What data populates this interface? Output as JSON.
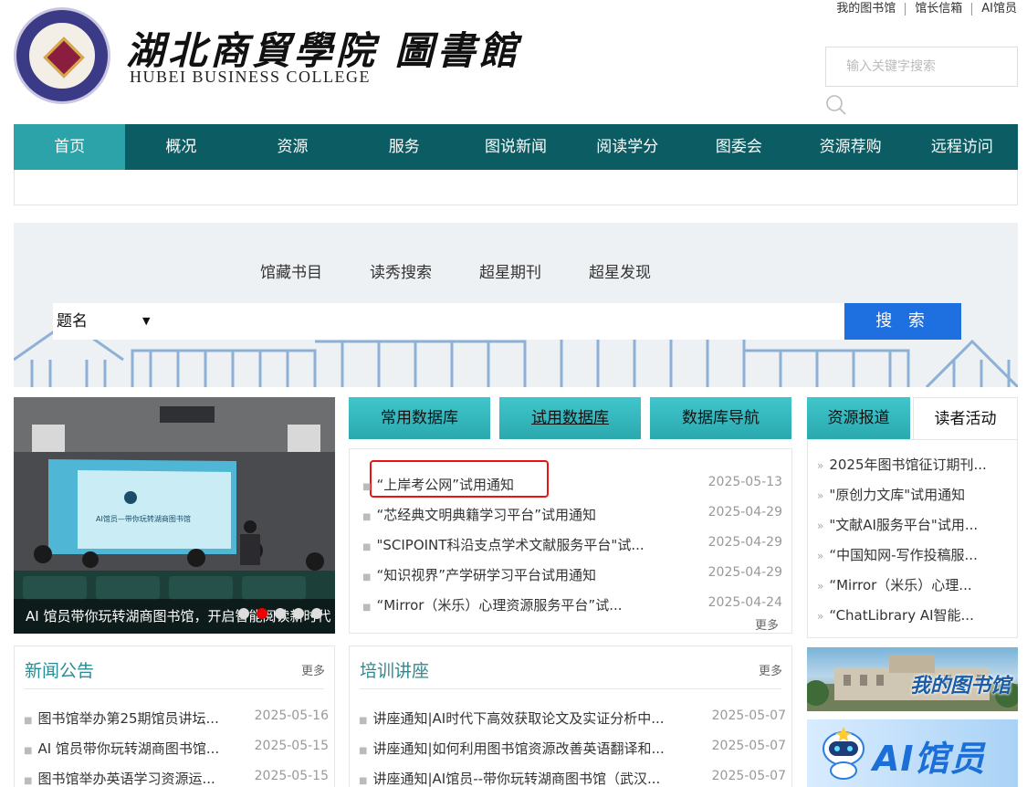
{
  "header": {
    "logo_cn": "湖北商貿學院 圖書館",
    "logo_en": "HUBEI BUSINESS COLLEGE",
    "seal_text": "湖北商貿學院",
    "top_links": [
      "我的图书馆",
      "馆长信箱",
      "AI馆员"
    ],
    "search_placeholder": "输入关键字搜索"
  },
  "nav": {
    "items": [
      "首页",
      "概况",
      "资源",
      "服务",
      "图说新闻",
      "阅读学分",
      "图委会",
      "资源荐购",
      "远程访问"
    ],
    "active": "首页"
  },
  "catalog_search": {
    "tabs": [
      "馆藏书目",
      "读秀搜索",
      "超星期刊",
      "超星发现"
    ],
    "field_type": "题名",
    "button": "搜 索"
  },
  "slider": {
    "caption": "AI 馆员带你玩转湖商图书馆，开启智能阅读新时代",
    "screen_text": "AI馆员—带你玩转湖商图书馆",
    "dots": 5,
    "active_dot": 1
  },
  "databases": {
    "tabs": [
      "常用数据库",
      "试用数据库",
      "数据库导航"
    ],
    "active_tab": "试用数据库",
    "items": [
      {
        "title": "“上岸考公网”试用通知",
        "date": "2025-05-13"
      },
      {
        "title": "“芯经典文明典籍学习平台”试用通知",
        "date": "2025-04-29"
      },
      {
        "title": "\"SCIPOINT科沿支点学术文献服务平台\"试...",
        "date": "2025-04-29"
      },
      {
        "title": "“知识视界”产学研学习平台试用通知",
        "date": "2025-04-29"
      },
      {
        "title": "“Mirror（米乐）心理资源服务平台”试...",
        "date": "2025-04-24"
      }
    ],
    "more": "更多"
  },
  "activities": {
    "tabs": [
      "资源报道",
      "读者活动"
    ],
    "items": [
      "2025年图书馆征订期刊...",
      "\"原创力文库\"试用通知",
      "\"文献AI服务平台\"试用...",
      "“中国知网-写作投稿服...",
      "“Mirror（米乐）心理...",
      "“ChatLibrary AI智能..."
    ]
  },
  "news": {
    "title": "新闻公告",
    "more": "更多",
    "items": [
      {
        "title": "图书馆举办第25期馆员讲坛...",
        "date": "2025-05-16"
      },
      {
        "title": "AI 馆员带你玩转湖商图书馆...",
        "date": "2025-05-15"
      },
      {
        "title": "图书馆举办英语学习资源运...",
        "date": "2025-05-15"
      }
    ]
  },
  "training": {
    "title": "培训讲座",
    "more": "更多",
    "items": [
      {
        "title": "讲座通知|AI时代下高效获取论文及实证分析中...",
        "date": "2025-05-07"
      },
      {
        "title": "讲座通知|如何利用图书馆资源改善英语翻译和...",
        "date": "2025-05-07"
      },
      {
        "title": "讲座通知|AI馆员--带你玩转湖商图书馆（武汉...",
        "date": "2025-05-07"
      }
    ]
  },
  "promos": {
    "my_library": "我的图书馆",
    "ai_librarian": "AI馆员"
  },
  "colors": {
    "nav_bg": "#0c5c63",
    "nav_active": "#2ca3a8",
    "tab_teal": "#35b8bd",
    "search_blue": "#1e6fe0",
    "highlight_red": "#e11111"
  }
}
